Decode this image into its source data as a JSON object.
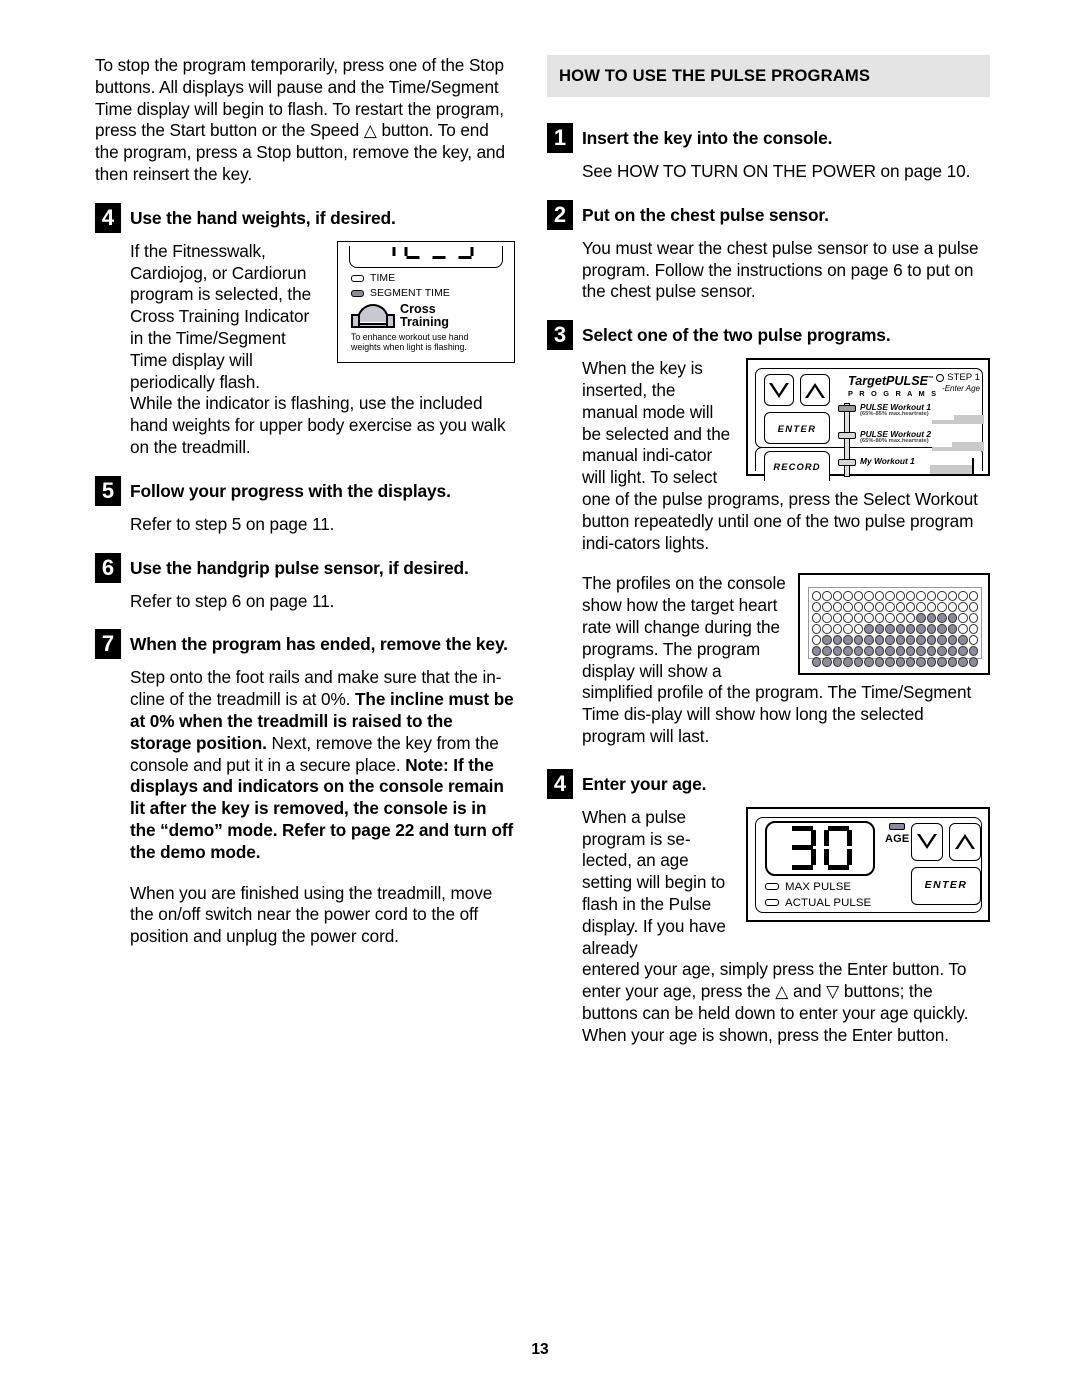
{
  "page_number": "13",
  "left_column": {
    "intro_paragraph": "To stop the program temporarily, press one of the Stop buttons. All displays will pause and the Time/Segment Time display will begin to flash. To restart the program, press the Start button or the Speed △ button. To end the program, press a Stop button, remove the key, and then reinsert the key.",
    "steps": [
      {
        "number": "4",
        "title": "Use the hand weights, if desired.",
        "body_part1": "If the Fitnesswalk, Cardiojog, or Cardiorun program is selected, the Cross Training Indicator in the Time/Segment Time display will periodically flash.",
        "body_part2": "While the indicator is flashing, use the included hand weights for upper body exercise as you walk on the treadmill."
      },
      {
        "number": "5",
        "title": "Follow your progress with the displays.",
        "body": "Refer to step 5 on page 11."
      },
      {
        "number": "6",
        "title": "Use the handgrip pulse sensor, if desired.",
        "body": "Refer to step 6 on page 11."
      },
      {
        "number": "7",
        "title": "When the program has ended, remove the key.",
        "body_a": "Step onto the foot rails and make sure that the in-cline of the treadmill is at 0%. ",
        "body_b_bold": "The incline must be at 0% when the treadmill is raised to the storage position.",
        "body_c": " Next, remove the key from the console and put it in a secure place. ",
        "body_d_bold": "Note: If the displays and indicators on the console remain lit after the key is removed, the console is in the “demo” mode. Refer to page 22 and turn off the demo mode.",
        "closing": "When you are finished using the treadmill, move the on/off switch near the power cord to the off position and unplug the power cord."
      }
    ],
    "cross_training_figure": {
      "time_label": "TIME",
      "segment_time_label": "SEGMENT TIME",
      "cross_label_line1": "Cross",
      "cross_label_line2": "Training",
      "note_line1": "To enhance workout use hand",
      "note_line2": "weights when light is flashing."
    }
  },
  "right_column": {
    "section_header": "HOW TO USE THE PULSE PROGRAMS",
    "steps": [
      {
        "number": "1",
        "title": "Insert the key into the console.",
        "body": "See HOW TO TURN ON THE POWER on page 10."
      },
      {
        "number": "2",
        "title": "Put on the chest pulse sensor.",
        "body": "You must wear the chest pulse sensor to use a pulse program. Follow the instructions on page 6 to put on the chest pulse sensor."
      },
      {
        "number": "3",
        "title": "Select one of the two pulse programs.",
        "body_a": "When the key is inserted, the manual mode will be selected and the manual indi-cator will light. To select one of the pulse programs, press the Select Workout button repeatedly until one of the two pulse program indi-cators lights.",
        "body_b": "The profiles on the console show how the target heart rate will change during the programs. The program display will show a simplified profile of the program. The Time/Segment Time dis-play will show how long the selected program will last."
      },
      {
        "number": "4",
        "title": "Enter your age.",
        "body_a": "When a pulse program is se-lected, an age setting will begin to flash in the Pulse display. If you have already",
        "body_b": "entered your age, simply press the Enter button. To enter your age, press the △ and ▽ buttons; the buttons can be held down to enter your age quickly. When your age is shown, press the Enter button."
      }
    ],
    "targetpulse_figure": {
      "brand": "TargetPULSE",
      "trademark": "™",
      "programs_word": "P R O G R A M S",
      "step_indicator": "STEP 1",
      "enter_age": "-Enter Age",
      "enter_button": "ENTER",
      "record_button": "RECORD",
      "workouts": [
        {
          "name": "PULSE Workout 1",
          "range": "(65%-85% max.heartrate)"
        },
        {
          "name": "PULSE Workout 2",
          "range": "(65%-80% max.heartrate)"
        },
        {
          "name": "My Workout 1",
          "range": ""
        }
      ]
    },
    "age_figure": {
      "value": "30",
      "age_label": "AGE",
      "max_pulse_label": "MAX PULSE",
      "actual_pulse_label": "ACTUAL PULSE",
      "enter_button": "ENTER"
    }
  },
  "dot_matrix": {
    "rows": 7,
    "cols": 16,
    "pattern": [
      [
        0,
        0,
        0,
        0,
        0,
        0,
        0,
        0,
        0,
        0,
        0,
        0,
        0,
        0,
        0,
        0
      ],
      [
        0,
        0,
        0,
        0,
        0,
        0,
        0,
        0,
        0,
        0,
        0,
        0,
        0,
        0,
        0,
        0
      ],
      [
        0,
        0,
        0,
        0,
        0,
        0,
        0,
        0,
        0,
        0,
        1,
        1,
        1,
        1,
        0,
        0
      ],
      [
        0,
        0,
        0,
        0,
        0,
        1,
        1,
        1,
        1,
        1,
        1,
        1,
        1,
        1,
        0,
        0
      ],
      [
        0,
        1,
        1,
        1,
        1,
        1,
        1,
        1,
        1,
        1,
        1,
        1,
        1,
        1,
        1,
        0
      ],
      [
        1,
        1,
        1,
        1,
        1,
        1,
        1,
        1,
        1,
        1,
        1,
        1,
        1,
        1,
        1,
        1
      ],
      [
        1,
        1,
        1,
        1,
        1,
        1,
        1,
        1,
        1,
        1,
        1,
        1,
        1,
        1,
        1,
        1
      ]
    ]
  }
}
